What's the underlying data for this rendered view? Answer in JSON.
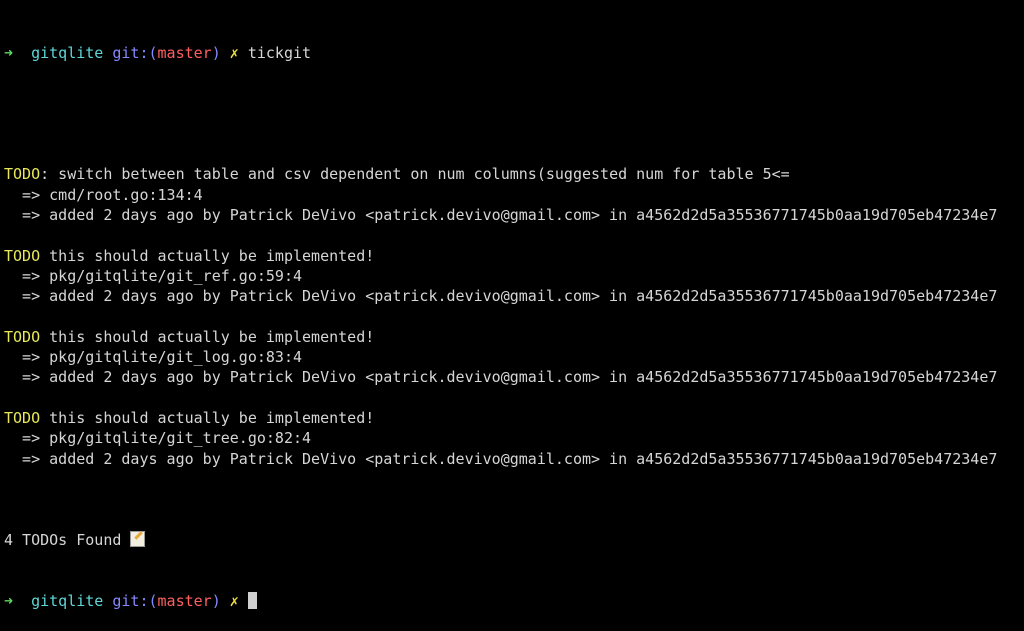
{
  "prompt": {
    "arrow": "➜",
    "dir": "gitqlite",
    "git_label": "git:(",
    "branch": "master",
    "git_close": ")",
    "dirty": "✗",
    "command": "tickgit"
  },
  "todos": [
    {
      "tag": "TODO",
      "text": ": switch between table and csv dependent on num columns(suggested num for table 5<=",
      "location": "  => cmd/root.go:134:4",
      "meta": "  => added 2 days ago by Patrick DeVivo <patrick.devivo@gmail.com> in a4562d2d5a35536771745b0aa19d705eb47234e7"
    },
    {
      "tag": "TODO",
      "text": " this should actually be implemented!",
      "location": "  => pkg/gitqlite/git_ref.go:59:4",
      "meta": "  => added 2 days ago by Patrick DeVivo <patrick.devivo@gmail.com> in a4562d2d5a35536771745b0aa19d705eb47234e7"
    },
    {
      "tag": "TODO",
      "text": " this should actually be implemented!",
      "location": "  => pkg/gitqlite/git_log.go:83:4",
      "meta": "  => added 2 days ago by Patrick DeVivo <patrick.devivo@gmail.com> in a4562d2d5a35536771745b0aa19d705eb47234e7"
    },
    {
      "tag": "TODO",
      "text": " this should actually be implemented!",
      "location": "  => pkg/gitqlite/git_tree.go:82:4",
      "meta": "  => added 2 days ago by Patrick DeVivo <patrick.devivo@gmail.com> in a4562d2d5a35536771745b0aa19d705eb47234e7"
    }
  ],
  "summary": "4 TODOs Found ",
  "summary_icon": "memo-icon",
  "colors": {
    "background": "#000000",
    "todo": "#e8e85a",
    "arrow": "#5fd75f",
    "dir": "#5fd7d7",
    "git": "#8787ff",
    "branch": "#ff5f5f"
  }
}
